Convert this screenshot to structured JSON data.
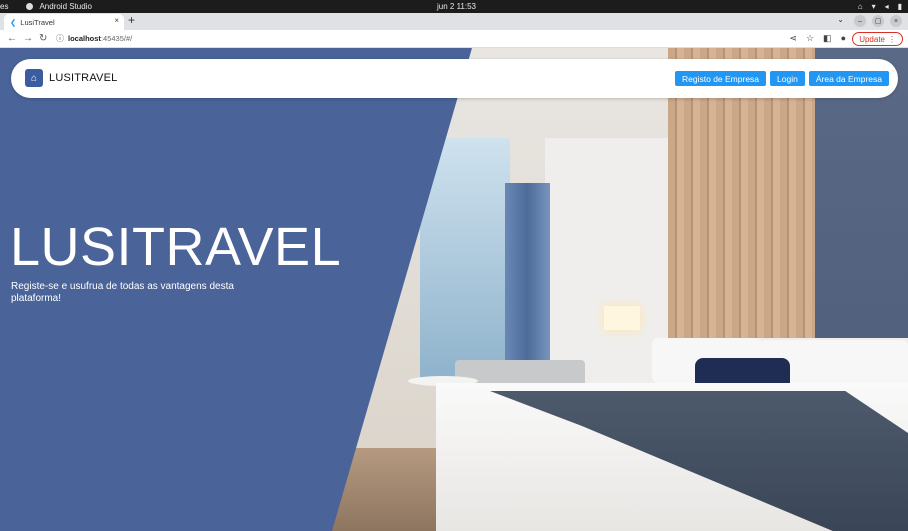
{
  "os": {
    "app_name": "Android Studio",
    "datetime": "jun 2  11:53",
    "left_fragment": "es"
  },
  "browser": {
    "tab_title": "LusiTravel",
    "tab_close": "×",
    "new_tab": "+",
    "url_host": "localhost",
    "url_rest": ":45435/#/",
    "update_label": "Update",
    "window_controls": [
      "–",
      "▢",
      "×"
    ]
  },
  "navbar": {
    "brand": "LUSITRAVEL",
    "buttons": [
      "Registo de Empresa",
      "Login",
      "Área da Empresa"
    ]
  },
  "hero": {
    "title": "LUSITRAVEL",
    "subtitle": "Registe-se e usufrua de todas as vantagens desta plataforma!"
  },
  "colors": {
    "hero_blue": "#4a6399",
    "button_blue": "#2196f3"
  }
}
